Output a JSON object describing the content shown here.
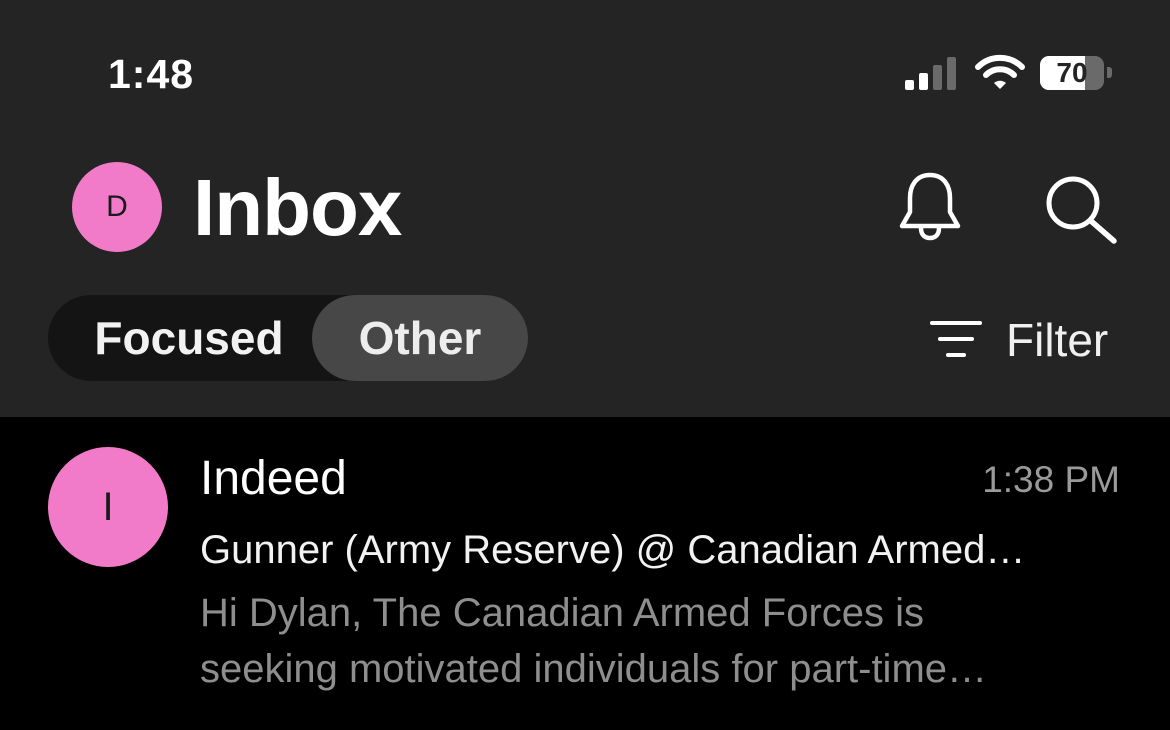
{
  "status_bar": {
    "time": "1:48",
    "battery_percent": 70,
    "battery_label": "70",
    "icons": [
      "cellular-signal-icon",
      "wifi-icon",
      "battery-icon"
    ]
  },
  "header": {
    "avatar_initial": "D",
    "title": "Inbox",
    "icons": [
      "bell-icon",
      "search-icon"
    ]
  },
  "tabs": {
    "items": [
      {
        "label": "Focused",
        "selected": false
      },
      {
        "label": "Other",
        "selected": true
      }
    ]
  },
  "filter": {
    "label": "Filter",
    "icon": "filter-icon"
  },
  "messages": [
    {
      "avatar_initial": "I",
      "sender": "Indeed",
      "time": "1:38 PM",
      "subject": "Gunner (Army Reserve) @ Canadian Armed…",
      "preview_line1": "Hi Dylan, The Canadian Armed Forces is",
      "preview_line2": "seeking motivated individuals for part-time…"
    }
  ],
  "colors": {
    "background": "#000000",
    "header_background": "#242424",
    "avatar_pink": "#f27bc9",
    "selected_tab": "#474747",
    "tab_group_background": "#141414",
    "secondary_text": "#8e8e8e"
  }
}
